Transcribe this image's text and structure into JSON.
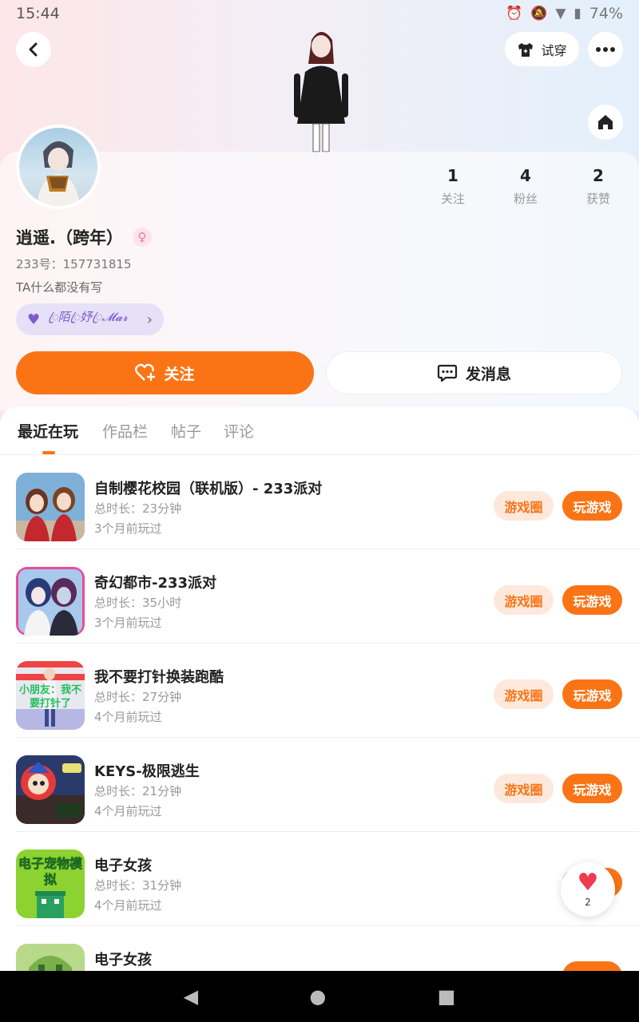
{
  "status_bar": {
    "time": "15:44",
    "battery": "74%"
  },
  "header": {
    "tryon_label": "试穿"
  },
  "profile": {
    "name": "逍遥.（跨年）",
    "gender_symbol": "♀",
    "uid": "233号：157731815",
    "bio": "TA什么都没有写",
    "relation_label": "ꦿ陌ꦿ妤ꦿ𝓜𝓪𝓻"
  },
  "stats": [
    {
      "value": "1",
      "label": "关注"
    },
    {
      "value": "4",
      "label": "粉丝"
    },
    {
      "value": "2",
      "label": "获赞"
    }
  ],
  "actions": {
    "follow": "关注",
    "message": "发消息"
  },
  "tabs": [
    "最近在玩",
    "作品栏",
    "帖子",
    "评论"
  ],
  "game_actions": {
    "circle": "游戏圈",
    "play": "玩游戏"
  },
  "games": [
    {
      "title": "自制樱花校园（联机版）- 233派对",
      "duration": "总时长：23分钟",
      "last_played": "3个月前玩过",
      "icon": "sakura-school-icon"
    },
    {
      "title": "奇幻都市-233派对",
      "duration": "总时长：35小时",
      "last_played": "3个月前玩过",
      "icon": "fantasy-city-icon"
    },
    {
      "title": "我不要打针换装跑酷",
      "duration": "总时长：27分钟",
      "last_played": "4个月前玩过",
      "icon": "no-injection-icon",
      "icon_text": "小朋友：我不要打针了"
    },
    {
      "title": "KEYS-极限逃生",
      "duration": "总时长：21分钟",
      "last_played": "4个月前玩过",
      "icon": "keys-escape-icon"
    },
    {
      "title": "电子女孩",
      "duration": "总时长：31分钟",
      "last_played": "4个月前玩过",
      "icon": "e-girl-icon",
      "icon_text": "电子宠物模拟"
    },
    {
      "title": "电子女孩",
      "icon": "e-girl-icon-2"
    }
  ],
  "like_float": {
    "count": "2"
  },
  "colors": {
    "accent": "#fa7416",
    "accent_light": "#fde8dc",
    "relation": "#7c5bd0",
    "like": "#ef3b4e"
  }
}
